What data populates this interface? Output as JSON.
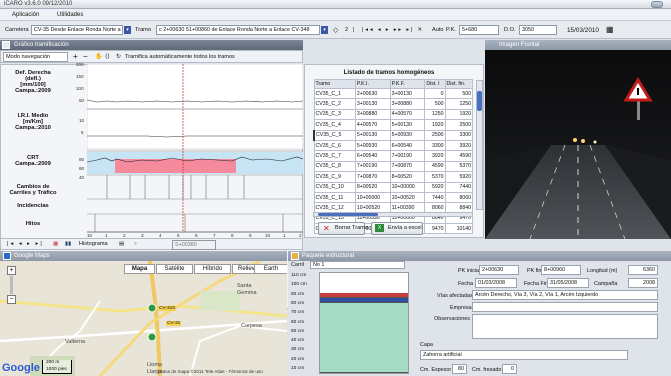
{
  "app": {
    "title": "iCARO v3.6.0 09/12/2010"
  },
  "menu": [
    "Aplicación",
    "Utilidades"
  ],
  "toolbar": {
    "carretera_label": "Carretera",
    "carretera_value": "CV-35 Desde Enlace Ronda Norte a",
    "tramo_label": "Tramo",
    "tramo_value": "c  2+00630  51+00860 de Enlace Ronda Norte a Enlace CV-348",
    "counter": "2",
    "auto_label": "Auto",
    "pk_label": "P.K.",
    "pk_value": "5+680",
    "do_label": "D.O.",
    "do_value": "3050",
    "date": "15/03/2010"
  },
  "graphic_panel": {
    "title": "Gráfico tramificación",
    "nav_label": "Modo navegación",
    "tramif_label": "Tramifica automáticamente todos los tramos",
    "rows": [
      {
        "label": "Def. Derecha\n(defl.)\n[mm/100]\nCampa.:2009",
        "ticks": [
          "200",
          "150",
          "100",
          "50"
        ]
      },
      {
        "label": "I.R.I. Medio\n[m/Km]\nCampa.:2010",
        "ticks": [
          "10",
          "5"
        ]
      },
      {
        "label": "CRT\nCampa.:2009",
        "ticks": [
          "80",
          "60",
          "40"
        ]
      },
      {
        "label": "Cambios de\nCarriles y Tráfico",
        "ticks": []
      },
      {
        "label": "Incidencias",
        "ticks": []
      },
      {
        "label": "Hitos",
        "ticks": []
      }
    ],
    "x_axis": [
      "10",
      "1",
      "2",
      "3",
      "4",
      "5",
      "6",
      "7",
      "8",
      "9",
      "10",
      "1",
      "2"
    ]
  },
  "segments": {
    "title": "Listado de tramos homogéneos",
    "columns": [
      "Tramo",
      "P.K.I.",
      "P.K.F.",
      "Dist. I",
      "Dist. fin."
    ],
    "rows": [
      [
        "CV35_C_1",
        "2+00630",
        "3+00130",
        "0",
        "500"
      ],
      [
        "CV35_C_2",
        "3+00130",
        "3+00880",
        "500",
        "1250"
      ],
      [
        "CV35_C_3",
        "3+00880",
        "4+00570",
        "1250",
        "1920"
      ],
      [
        "CV35_C_4",
        "4+00570",
        "5+00130",
        "1920",
        "2500"
      ],
      [
        "CV35_C_5",
        "5+00130",
        "5+00930",
        "2500",
        "3300"
      ],
      [
        "CV35_C_6",
        "5+00930",
        "6+00540",
        "3300",
        "3920"
      ],
      [
        "CV35_C_7",
        "6+00540",
        "7+00190",
        "3920",
        "4590"
      ],
      [
        "CV35_C_8",
        "7+00190",
        "7+00870",
        "4590",
        "5370"
      ],
      [
        "CV35_C_9",
        "7+00870",
        "8+00520",
        "5370",
        "5920"
      ],
      [
        "CV35_C_10",
        "8+00520",
        "10+00000",
        "5920",
        "7440"
      ],
      [
        "CV35_C_11",
        "10+00000",
        "10+00520",
        "7440",
        "8060"
      ],
      [
        "CV35_C_12",
        "10+00520",
        "11+00390",
        "8060",
        "8840"
      ],
      [
        "CV35_C_13",
        "11+00390",
        "12+00000",
        "8840",
        "9470"
      ],
      [
        "CV35_C_14",
        "12+00000",
        "12+00670",
        "9470",
        "10140"
      ]
    ],
    "selected_index": 4,
    "delete_label": "Borrar Tramo",
    "excel_label": "Envía a excel"
  },
  "front_image": {
    "title": "Imagen Frontal"
  },
  "bottom_toolbar": {
    "histogram_label": "Histograma",
    "readout": "S+00380"
  },
  "map": {
    "title": "Google Maps",
    "tabs": [
      "Mapa",
      "Satélite",
      "Híbrido",
      "Relieve",
      "Earth"
    ],
    "active_tab": "Mapa",
    "places": [
      "Santa",
      "Gemma",
      "Valterna",
      "Lloma",
      "Llarga",
      "CV-310",
      "CV-31",
      "Carpesa"
    ],
    "scale_m": "200 m",
    "scale_ft": "1000 pies",
    "attribution": "Datos de mapa ©2011 Tele Atlas - Términos de uso",
    "logo": "Google"
  },
  "firme": {
    "title": "Paquete estructural",
    "carril_label": "Carril",
    "carril_value": "No 1",
    "depth_ticks": [
      "110 cm",
      "100 cm",
      "90 cm",
      "80 cm",
      "70 cm",
      "60 cm",
      "50 cm",
      "40 cm",
      "30 cm",
      "20 cm",
      "10 cm"
    ],
    "layer_fraction": 0.8,
    "fields": {
      "pk_inicial_label": "PK inicial",
      "pk_inicial": "2+00630",
      "pk_final_label": "PK final",
      "pk_final": "8+00960",
      "longitud_label": "Longitud (m)",
      "longitud": "6360",
      "fecha_inicio_label": "Fecha Inicio",
      "fecha_inicio": "01/03/2008",
      "fecha_fin_label": "Fecha Fin",
      "fecha_fin": "31/05/2008",
      "campana_label": "Campaña",
      "campana": "2008",
      "vias_label": "Vías afectadas",
      "vias": "Arcén Derecho, Vía 3, Vía 2, Vía 1, Arcén Izquierdo",
      "empresa_label": "Empresa",
      "observaciones_label": "Observaciones",
      "capa_label": "Capa",
      "capa_value": "Zahorra artificial",
      "espesor_label": "Cm. Espesor",
      "espesor": "80",
      "fresado_label": "Cm. fresado",
      "fresado": "0"
    }
  },
  "colors": {
    "crt_band": "#f58a9c",
    "crt_band_bg": "#c6e4f3",
    "cursor": "#d62020",
    "layer_blue": "#2e4f9e",
    "layer_red": "#c53f3f",
    "layer_green": "#a5dcc5"
  }
}
